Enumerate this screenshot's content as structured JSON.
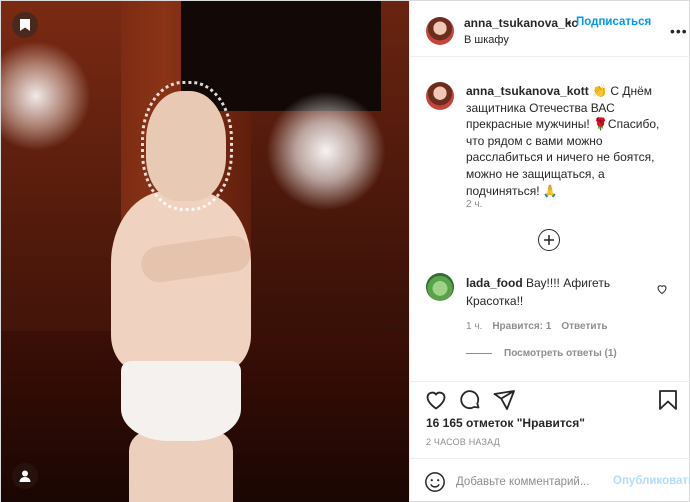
{
  "post": {
    "header": {
      "username": "anna_tsukanova_kc",
      "separator": "•",
      "follow_label": "Подписаться",
      "location": "В шкафу",
      "more_label": "•••"
    },
    "caption": {
      "username": "anna_tsukanova_kott",
      "text": "👏 С Днём защитника Отечества ВАС прекрасные мужчины! 🌹Спасибо, что рядом с вами можно расслабиться и ничего не боятся, можно не защищаться, а подчиняться! 🙏",
      "time": "2 ч."
    },
    "comment": {
      "username": "lada_food",
      "text": "Вау!!!! Афигеть Красотка!!",
      "time": "1 ч.",
      "likes": "Нравится: 1",
      "reply_label": "Ответить",
      "view_replies": "Посмотреть ответы (1)"
    },
    "likes_text": "16 165 отметок \"Нравится\"",
    "ago_text": "2 ЧАСОВ НАЗАД",
    "add_comment_placeholder": "Добавьте комментарий...",
    "publish_label": "Опубликовать"
  },
  "colors": {
    "accent": "#0095f6",
    "publish_disabled": "#b3dbff",
    "secondary_text": "#8e8e8e",
    "border": "#efefef"
  },
  "icons": {
    "save_overlay": "bookmark-icon",
    "tagged_user": "user-icon",
    "like": "heart-icon",
    "comment": "comment-icon",
    "share": "share-icon",
    "save": "bookmark-icon",
    "emoji": "smiley-icon",
    "more": "plus-circle-icon"
  }
}
